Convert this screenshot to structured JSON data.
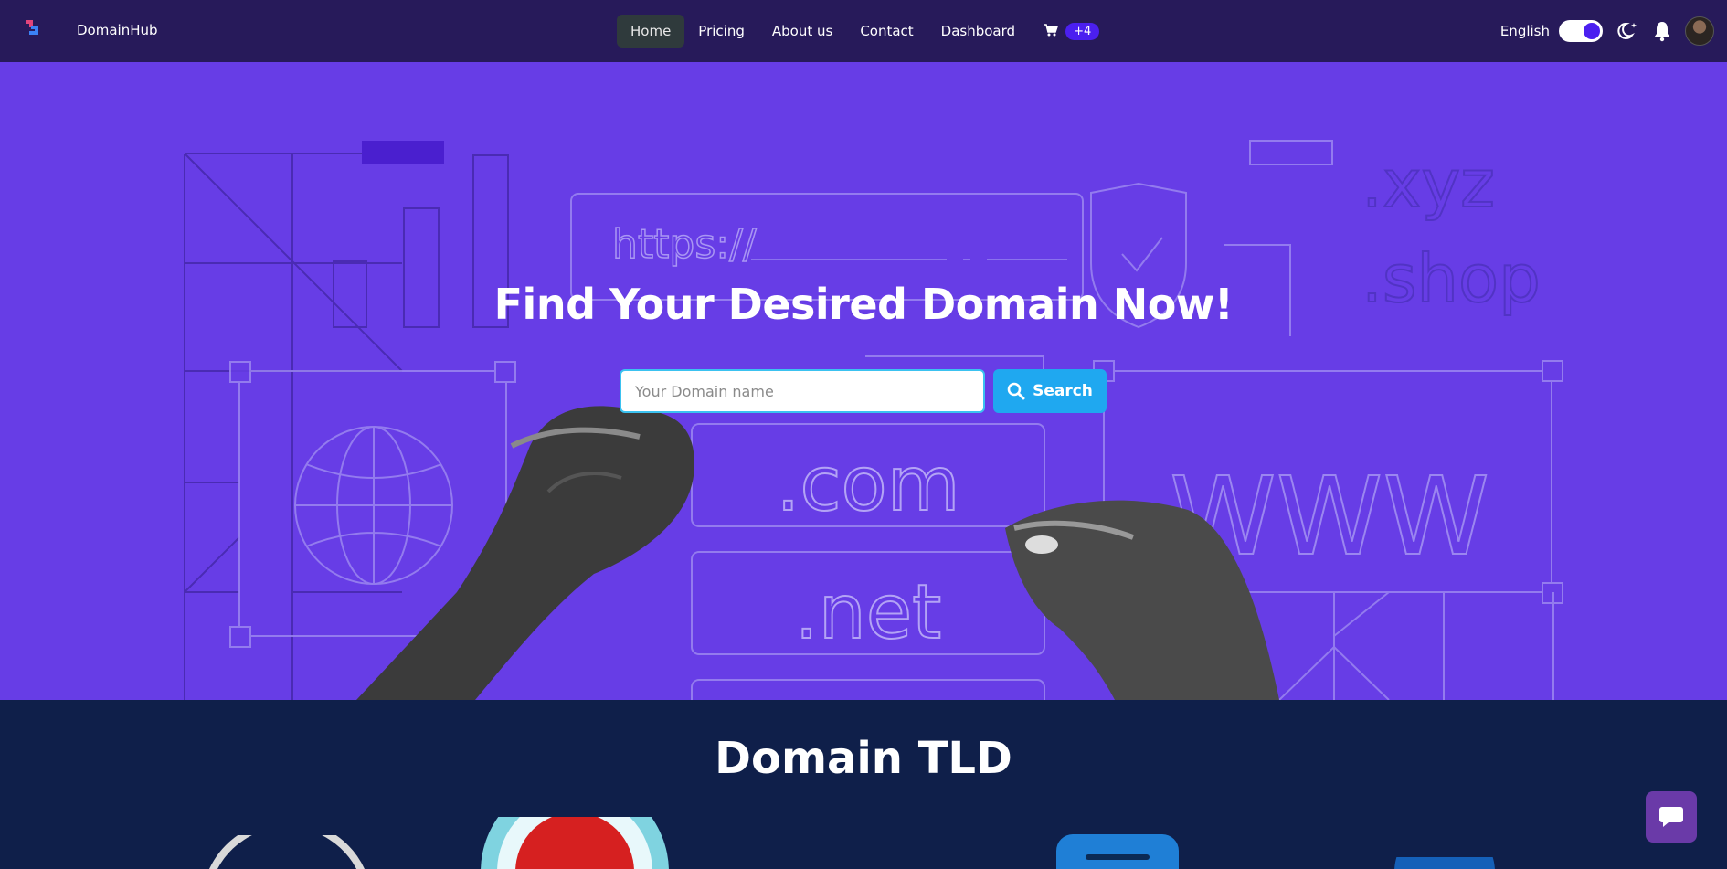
{
  "navbar": {
    "brand_name": "DomainHub",
    "items": [
      {
        "label": "Home",
        "active": true
      },
      {
        "label": "Pricing",
        "active": false
      },
      {
        "label": "About us",
        "active": false
      },
      {
        "label": "Contact",
        "active": false
      },
      {
        "label": "Dashboard",
        "active": false
      }
    ],
    "cart_badge": "+4",
    "language": "English",
    "theme_toggle_on": true,
    "icons": [
      "cart-icon",
      "moon-icon",
      "bell-icon"
    ]
  },
  "hero": {
    "title": "Find Your Desired Domain Now!",
    "search_placeholder": "Your Domain name",
    "search_value": "",
    "search_button": "Search",
    "art_text": {
      "url": "https://",
      "tld_com": ".com",
      "tld_net": ".net",
      "www": "WWW",
      "xyz": ".xyz",
      "shop": ".shop"
    }
  },
  "tld_section": {
    "title": "Domain TLD"
  },
  "colors": {
    "navbar_bg": "#271a5a",
    "hero_bg": "#673de6",
    "section_bg": "#0f1f4a",
    "accent": "#4b1ff0",
    "search_button": "#1fa8f0",
    "chat_button": "#6a3aa8"
  }
}
